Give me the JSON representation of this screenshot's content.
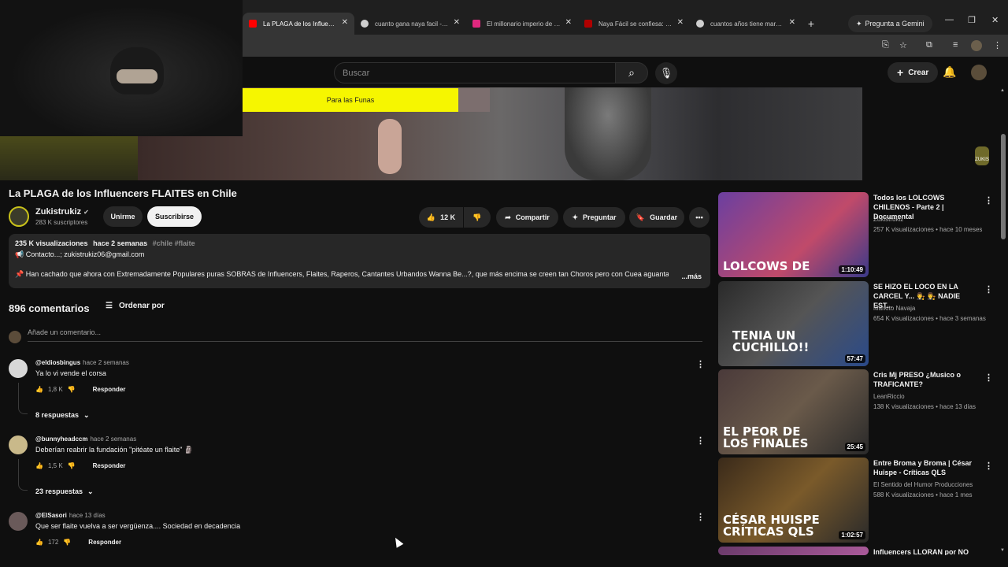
{
  "browser": {
    "tabs": [
      {
        "title": "La PLAGA de los Influencers FLAITES en Chile",
        "favicon_color": "#ff0000",
        "active": true
      },
      {
        "title": "cuanto gana naya facil - Buscar con Google",
        "favicon_color": "#cfcfcf",
        "active": false
      },
      {
        "title": "El millonario imperio de Naya Fácil",
        "favicon_color": "#e0287e",
        "active": false
      },
      {
        "title": "Naya Fácil se confiesa: cuánto gana",
        "favicon_color": "#b00000",
        "active": false
      },
      {
        "title": "cuantos años tiene markus - Buscar con Google",
        "favicon_color": "#cfcfcf",
        "active": false
      }
    ],
    "gemini_label": "Pregunta a Gemini",
    "new_tab": "+"
  },
  "youtube": {
    "search_placeholder": "Buscar",
    "create_label": "Crear"
  },
  "video_overlay": {
    "banner_text": "Para las Funas",
    "mascot_text": "ZUKIS"
  },
  "video": {
    "title": "La PLAGA de los Influencers FLAITES en Chile",
    "channel": "Zukistrukiz",
    "subscribers": "283 K suscriptores",
    "join_label": "Unirme",
    "subscribe_label": "Suscribirse",
    "likes": "12 K",
    "share_label": "Compartir",
    "ask_label": "Preguntar",
    "save_label": "Guardar"
  },
  "description": {
    "views": "235 K visualizaciones",
    "age": "hace 2 semanas",
    "tags": "#chile #flaite",
    "contact": "📢 Contacto...; zukistrukiz06@gmail.com",
    "body": "📌 Han cachado que ahora con Extremadamente Populares puras SOBRAS de Influencers, Flaites, Raperos, Cantantes Urbandos Wanna Be...?, que más encima se creen tan Choros pero con Cuea aguanta",
    "more": "...más"
  },
  "comments": {
    "count": "896 comentarios",
    "sort_label": "Ordenar por",
    "add_placeholder": "Añade un comentario...",
    "items": [
      {
        "author": "@eldiosbingus",
        "ago": "hace 2 semanas",
        "text": "Ya lo vi vende el corsa",
        "likes": "1,8 K",
        "reply": "Responder",
        "replies": "8 respuestas",
        "avatar_color": "#d8d8d8"
      },
      {
        "author": "@bunnyheadccm",
        "ago": "hace 2 semanas",
        "text": "Deberían reabrir la fundación \"pitéate un flaite\" 🗿",
        "likes": "1,5 K",
        "reply": "Responder",
        "replies": "23 respuestas",
        "avatar_color": "#c9b98a"
      },
      {
        "author": "@ElSasori",
        "ago": "hace 13 días",
        "text": "Que ser flaite vuelva a ser vergüenza.... Sociedad en decadencia",
        "likes": "172",
        "reply": "Responder",
        "avatar_color": "#6a5a5a"
      }
    ]
  },
  "recommendations": [
    {
      "title": "Todos los LOLCOWS CHILENOS - Parte 2 | Documental",
      "channel": "Zukistrukiz",
      "stats": "257 K visualizaciones • hace 10 meses",
      "duration": "1:10:49",
      "caption": "LOLCOWS DE",
      "thumb_bg": "#6b3fa0",
      "cap_color": "#ffffff"
    },
    {
      "title": "SE HIZO EL LOCO EN LA CARCEL Y... 👨‍⚖️ 👨‍⚖️ NADIE EST...",
      "channel": "Markito Navaja",
      "stats": "654 K visualizaciones • hace 3 semanas",
      "duration": "57:47",
      "caption": "TENIA UN CUCHILLO!!",
      "thumb_bg": "#3a3a3a",
      "cap_color": "#ffffff"
    },
    {
      "title": "Cris Mj PRESO ¿Musico o TRAFICANTE?",
      "channel": "LeanRiccio",
      "stats": "138 K visualizaciones • hace 13 días",
      "duration": "25:45",
      "caption": "EL PEOR DE LOS FINALES",
      "thumb_bg": "#4a3a3a",
      "cap_color": "#ffffff"
    },
    {
      "title": "Entre Broma y Broma | César Huispe - Críticas QLS",
      "channel": "El Sentido del Humor Producciones",
      "stats": "588 K visualizaciones • hace 1 mes",
      "duration": "1:02:57",
      "caption": "CÉSAR HUISPE CRÍTICAS QLS",
      "thumb_bg": "#5a4a2a",
      "cap_color": "#ffffff"
    },
    {
      "title": "Influencers LLORAN por NO",
      "channel": "",
      "stats": "",
      "duration": "",
      "caption": "",
      "thumb_bg": "#6a3a6a",
      "cap_color": "#ffffff"
    }
  ]
}
